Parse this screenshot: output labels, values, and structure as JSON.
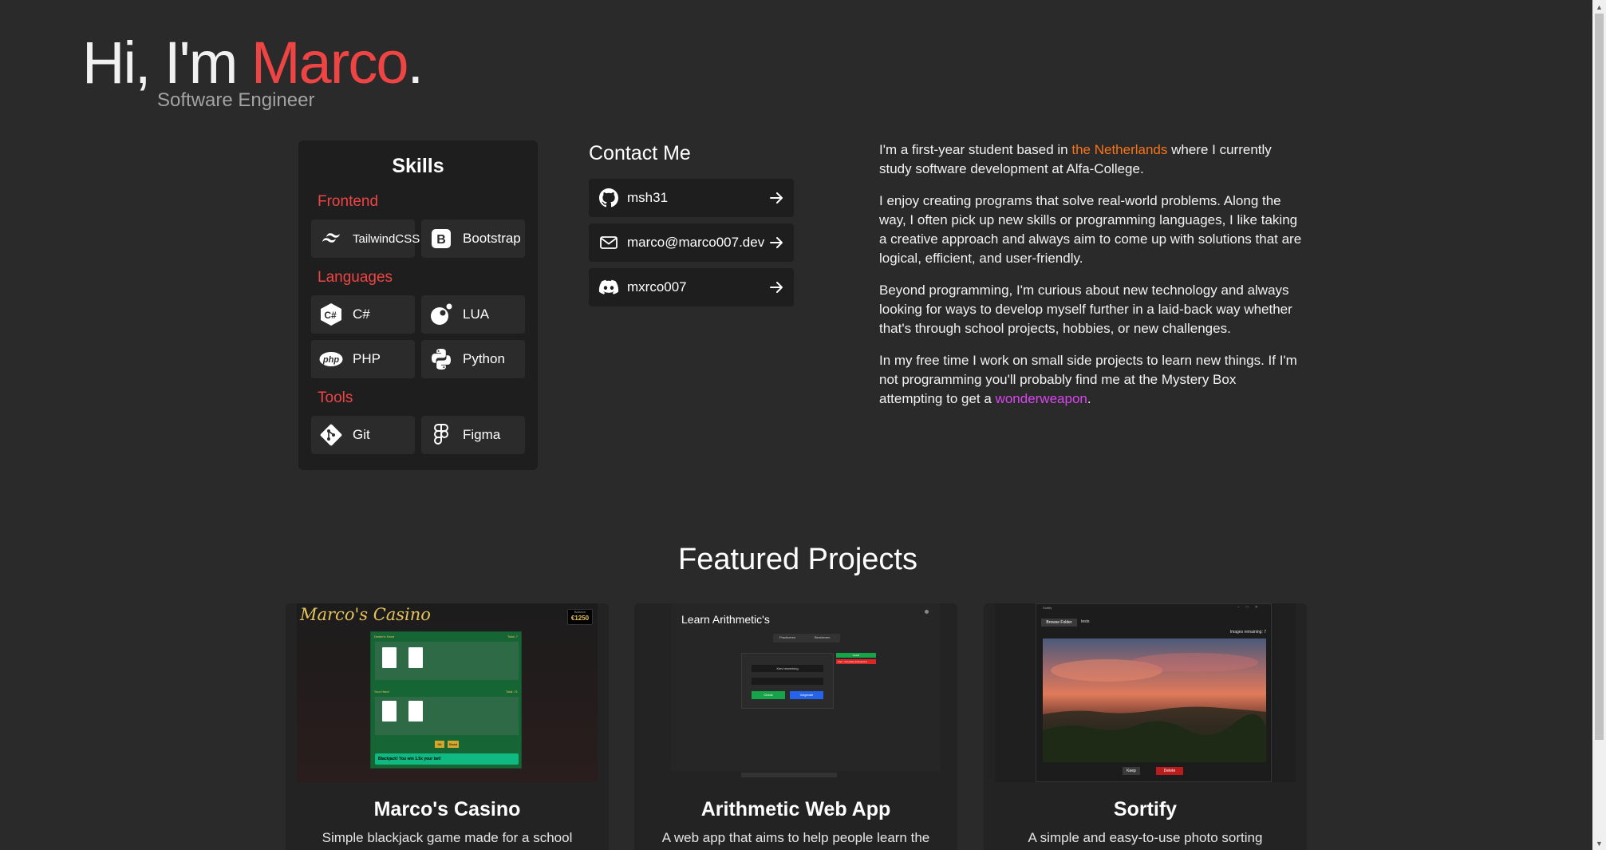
{
  "hero": {
    "greeting": "Hi, I'm ",
    "name": "Marco",
    "period": ".",
    "subtitle": "Software Engineer"
  },
  "skills": {
    "title": "Skills",
    "frontend_label": "Frontend",
    "frontend": [
      "TailwindCSS",
      "Bootstrap"
    ],
    "languages_label": "Languages",
    "languages": [
      "C#",
      "LUA",
      "PHP",
      "Python"
    ],
    "tools_label": "Tools",
    "tools": [
      "Git",
      "Figma"
    ]
  },
  "contact": {
    "title": "Contact Me",
    "github": "msh31",
    "email": "marco@marco007.dev",
    "discord": "mxrco007"
  },
  "about": {
    "p1_a": "I'm a first-year student based in ",
    "p1_link": "the Netherlands",
    "p1_b": " where I currently study software development at Alfa-College.",
    "p2": "I enjoy creating programs that solve real-world problems. Along the way, I often pick up new skills or programming languages, I like taking a creative approach and always aim to come up with solutions that are logical, efficient, and user-friendly.",
    "p3": "Beyond programming, I'm curious about new technology and always looking for ways to develop myself further in a laid-back way whether that's through school projects, hobbies, or new challenges.",
    "p4_a": "In my free time I work on small side projects to learn new things. If I'm not programming you'll probably find me at the Mystery Box attempting to get a ",
    "p4_link": "wonderweapon",
    "p4_b": "."
  },
  "projects": {
    "heading": "Featured Projects",
    "items": [
      {
        "title": "Marco's Casino",
        "desc": "Simple blackjack game made for a school",
        "thumb": {
          "logo": "Marco's Casino",
          "balance_label": "Balance",
          "balance": "€1250",
          "dealer_label": "Dealer's Hand",
          "dealer_total": "Total: 7",
          "player_label": "Your Hand",
          "player_total": "Total: 21",
          "hit": "Hit",
          "stand": "Stand",
          "result": "Blackjack! You win 1.5x your bet!"
        }
      },
      {
        "title": "Arithmetic Web App",
        "desc": "A web app that aims to help people learn the",
        "thumb": {
          "heading": "Learn Arithmetic's",
          "tab1": "Practiceren",
          "tab2": "Berekenen",
          "select": "Kies bewerking",
          "check": "Check",
          "next": "Volgende",
          "correct": "Goed!",
          "wrong": "Fout - het juiste antwoord is"
        }
      },
      {
        "title": "Sortify",
        "desc": "A simple and easy-to-use photo sorting",
        "thumb": {
          "window_title": "Sortify",
          "browse": "Browse Folder",
          "folder": "tests",
          "remaining": "Images remaining: 7",
          "keep": "Keep",
          "delete": "Delete"
        }
      }
    ]
  },
  "colors": {
    "background": "#2a2a2a",
    "accent_red": "#ef4444",
    "accent_orange": "#f97316",
    "accent_purple": "#d946ef",
    "panel": "#1e1e1e"
  }
}
